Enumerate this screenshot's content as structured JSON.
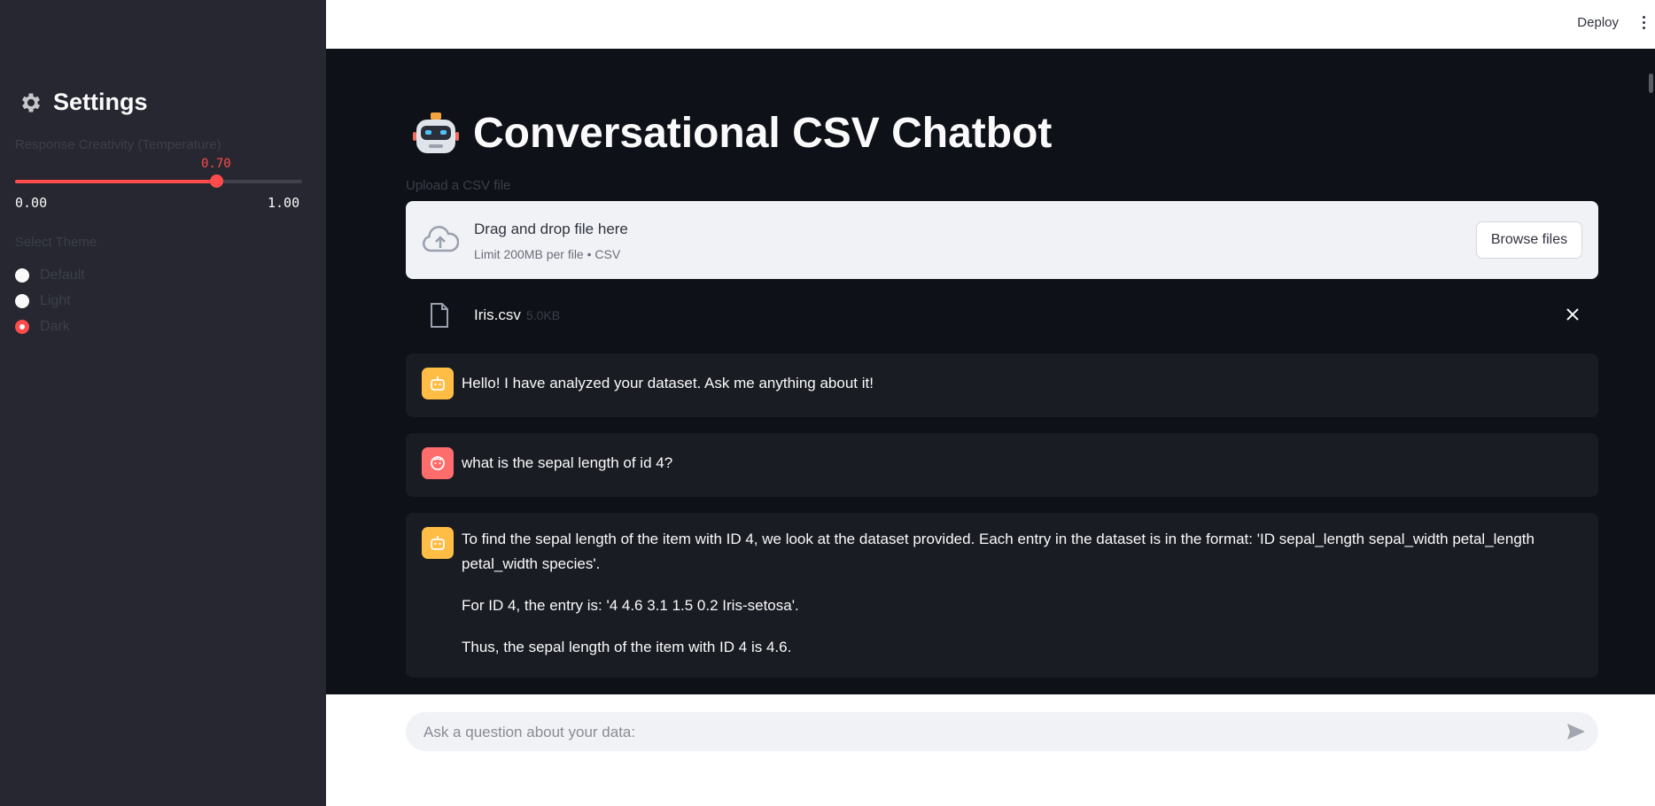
{
  "sidebar": {
    "title": "Settings",
    "title_icon": "gear-icon",
    "slider": {
      "label": "Response Creativity (Temperature)",
      "value_text": "0.70",
      "value": 0.7,
      "min_text": "0.00",
      "max_text": "1.00",
      "min": 0.0,
      "max": 1.0
    },
    "theme": {
      "label": "Select Theme",
      "options": [
        "Default",
        "Light",
        "Dark"
      ],
      "selected": "Dark"
    }
  },
  "header": {
    "deploy_label": "Deploy",
    "menu_icon": "kebab-menu-icon"
  },
  "main": {
    "title": "Conversational CSV Chatbot",
    "title_icon": "robot-icon",
    "uploader": {
      "label": "Upload a CSV file",
      "drop_title": "Drag and drop file here",
      "drop_subtitle": "Limit 200MB per file • CSV",
      "browse_label": "Browse files",
      "icon": "cloud-upload-icon"
    },
    "file": {
      "name": "Iris.csv",
      "size": "5.0KB",
      "icon": "file-icon"
    },
    "messages": [
      {
        "role": "assistant",
        "paragraphs": [
          "Hello! I have analyzed your dataset. Ask me anything about it!"
        ]
      },
      {
        "role": "user",
        "paragraphs": [
          "what is the sepal length of id 4?"
        ]
      },
      {
        "role": "assistant",
        "paragraphs": [
          "To find the sepal length of the item with ID 4, we look at the dataset provided. Each entry in the dataset is in the format: 'ID sepal_length sepal_width petal_length petal_width species'.",
          "For ID 4, the entry is: '4 4.6 3.1 1.5 0.2 Iris-setosa'.",
          "Thus, the sepal length of the item with ID 4 is 4.6."
        ]
      }
    ]
  },
  "chat_input": {
    "placeholder": "Ask a question about your data:",
    "send_icon": "send-icon"
  },
  "colors": {
    "accent": "#ff4b4b",
    "sidebar_bg": "#262730",
    "main_bg": "#0e1117",
    "assistant_avatar": "#ffbd45",
    "user_avatar": "#ff6c6c"
  }
}
